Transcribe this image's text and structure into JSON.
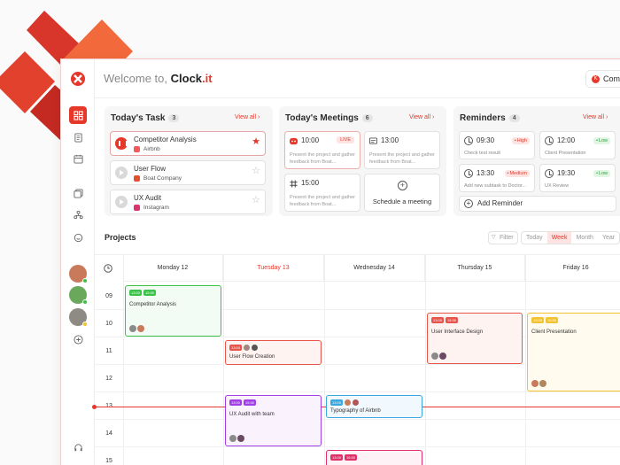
{
  "header": {
    "welcome_prefix": "Welcome to, ",
    "app_name_main": "Clock",
    "app_name_suffix": ".it",
    "company_label": "Comp",
    "company_initial": "K"
  },
  "tasks": {
    "title": "Today's Task",
    "count": "3",
    "view_all": "View all ›",
    "items": [
      {
        "name": "Competitor Analysis",
        "company": "Airbnb"
      },
      {
        "name": "User Flow",
        "company": "Boat Company"
      },
      {
        "name": "UX Audit",
        "company": "Instagram"
      }
    ]
  },
  "meetings": {
    "title": "Today's Meetings",
    "count": "6",
    "view_all": "View all ›",
    "live_label": "LIVE",
    "items": [
      {
        "time": "10:00",
        "desc": "Present the project and gather feedback from Boat..."
      },
      {
        "time": "13:00",
        "desc": "Present the project and gather feedback from Boat..."
      },
      {
        "time": "15:00",
        "desc": "Present the project and gather feedback from Boat..."
      }
    ],
    "schedule_label": "Schedule a meeting"
  },
  "reminders": {
    "title": "Reminders",
    "count": "4",
    "view_all": "View all ›",
    "items": [
      {
        "time": "09:30",
        "priority": "High",
        "desc": "Check test result"
      },
      {
        "time": "12:00",
        "priority": "Low",
        "desc": "Client Presentation"
      },
      {
        "time": "13:30",
        "priority": "Medium",
        "desc": "Add new subtask to Doctor..."
      },
      {
        "time": "19:30",
        "priority": "Low",
        "desc": "UX Review"
      }
    ],
    "add_label": "Add Reminder"
  },
  "projects": {
    "title": "Projects",
    "filter_label": "Filter",
    "views": [
      "Today",
      "Week",
      "Month",
      "Year"
    ],
    "selected_view": "Week",
    "days": [
      "Monday 12",
      "Tuesday 13",
      "Wednesday 14",
      "Thursday 15",
      "Friday 16"
    ],
    "today": "Tuesday 13",
    "hours": [
      "09",
      "10",
      "11",
      "12",
      "13",
      "14",
      "15"
    ],
    "tag_time_a": "13:00",
    "tag_time_b": "15:00",
    "events": [
      {
        "title": "Competitor Analysis"
      },
      {
        "title": "User Flow Creation"
      },
      {
        "title": "UX Audit with team"
      },
      {
        "title": "Typography of Airbnb"
      },
      {
        "title": "User Interface Design"
      },
      {
        "title": "Client Presentation"
      }
    ]
  },
  "colors": {
    "accent": "#e5382b",
    "green": "#3cc24a",
    "purple": "#a23ee6",
    "blue": "#3aa8e0",
    "pink": "#e0306a",
    "yellow": "#f2c230",
    "coral": "#e8534a"
  }
}
